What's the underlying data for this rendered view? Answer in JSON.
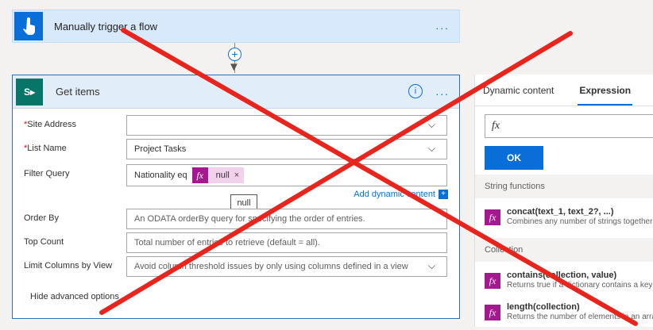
{
  "trigger": {
    "title": "Manually trigger a flow",
    "more": "..."
  },
  "action": {
    "title": "Get items",
    "icon_text": "S",
    "info": "i",
    "more": "...",
    "fields": {
      "site_address": {
        "label": "Site Address",
        "value": ""
      },
      "list_name": {
        "label": "List Name",
        "value": "Project Tasks"
      },
      "filter_query": {
        "label": "Filter Query",
        "prefix": "Nationality eq",
        "token": "null",
        "token_fx": "fx",
        "token_remove": "×"
      },
      "order_by": {
        "label": "Order By",
        "placeholder": "An ODATA orderBy query for specifying the order of entries."
      },
      "top_count": {
        "label": "Top Count",
        "placeholder": "Total number of entries to retrieve (default = all)."
      },
      "limit_columns": {
        "label": "Limit Columns by View",
        "placeholder": "Avoid column threshold issues by only using columns defined in a view"
      }
    },
    "tooltip": "null",
    "add_dynamic": "Add dynamic content",
    "add_dynamic_icon": "+",
    "hide_advanced": "Hide advanced options"
  },
  "panel": {
    "tabs": [
      "Dynamic content",
      "Expression"
    ],
    "expression_placeholder": "fx",
    "ok_label": "OK",
    "sections": [
      {
        "title": "String functions",
        "items": [
          {
            "name": "concat(text_1, text_2?, ...)",
            "desc": "Combines any number of strings together"
          }
        ]
      },
      {
        "title": "Collection",
        "items": [
          {
            "name": "contains(collection, value)",
            "desc": "Returns true if a dictionary contains a key"
          },
          {
            "name": "length(collection)",
            "desc": "Returns the number of elements in an array"
          }
        ]
      }
    ]
  },
  "colors": {
    "accent": "#0a6ed8",
    "fx_token": "#a4198f",
    "overlay_x": "#e8241c",
    "sharepoint": "#077568"
  }
}
